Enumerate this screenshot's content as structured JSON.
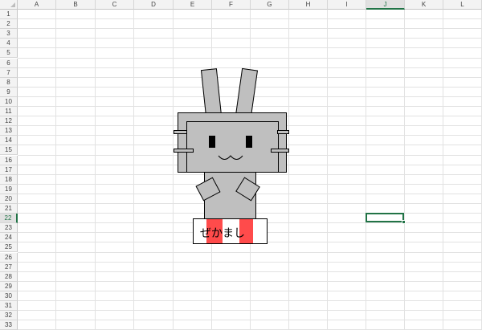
{
  "sheet": {
    "columns": [
      "A",
      "B",
      "C",
      "D",
      "E",
      "F",
      "G",
      "H",
      "I",
      "J",
      "K",
      "L"
    ],
    "rows": [
      "1",
      "2",
      "3",
      "4",
      "5",
      "6",
      "7",
      "8",
      "9",
      "10",
      "11",
      "12",
      "13",
      "14",
      "15",
      "16",
      "17",
      "18",
      "19",
      "20",
      "21",
      "22",
      "23",
      "24",
      "25",
      "26",
      "27",
      "28",
      "29",
      "30",
      "31",
      "32",
      "33"
    ],
    "active_column": "J",
    "active_row": "22"
  },
  "drawing": {
    "name_label": "ぜかまし",
    "colors": {
      "body_fill": "#bfbfbf",
      "stripe": "#ff4b4b",
      "outline": "#000000",
      "selection": "#217346"
    }
  }
}
